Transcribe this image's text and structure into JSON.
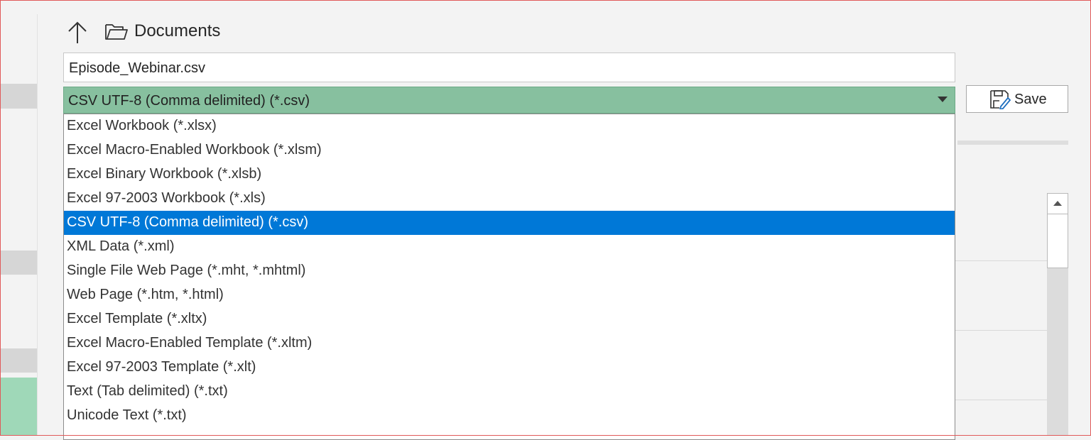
{
  "location": {
    "folder": "Documents"
  },
  "filename": {
    "value": "Episode_Webinar.csv"
  },
  "file_type": {
    "selected": "CSV UTF-8 (Comma delimited) (*.csv)",
    "options": [
      "Excel Workbook (*.xlsx)",
      "Excel Macro-Enabled Workbook (*.xlsm)",
      "Excel Binary Workbook (*.xlsb)",
      "Excel 97-2003 Workbook (*.xls)",
      "CSV UTF-8 (Comma delimited) (*.csv)",
      "XML Data (*.xml)",
      "Single File Web Page (*.mht, *.mhtml)",
      "Web Page (*.htm, *.html)",
      "Excel Template (*.xltx)",
      "Excel Macro-Enabled Template (*.xltm)",
      "Excel 97-2003 Template (*.xlt)",
      "Text (Tab delimited) (*.txt)",
      "Unicode Text (*.txt)"
    ],
    "highlighted_index": 4
  },
  "save_button": {
    "label": "Save"
  },
  "colors": {
    "selected_field_bg": "#87c09f",
    "highlight_bg": "#0078d7",
    "nav_green": "#9fd8b8"
  }
}
